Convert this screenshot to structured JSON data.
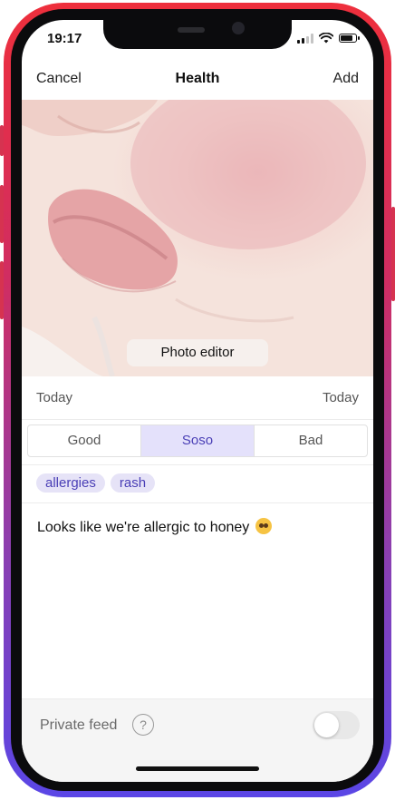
{
  "status": {
    "time": "19:17",
    "battery_level": 0.85
  },
  "navbar": {
    "cancel_label": "Cancel",
    "title": "Health",
    "add_label": "Add"
  },
  "photo": {
    "editor_label": "Photo editor"
  },
  "date_row": {
    "left": "Today",
    "right": "Today"
  },
  "mood": {
    "options": [
      "Good",
      "Soso",
      "Bad"
    ],
    "selected": "Soso"
  },
  "tags": [
    "allergies",
    "rash"
  ],
  "note": {
    "text": "Looks like we're allergic to honey",
    "emoji_icon": "pleading-face-emoji"
  },
  "footer": {
    "private_label": "Private feed",
    "help_symbol": "?",
    "private_enabled": false
  },
  "colors": {
    "accent": "#4a3fb6",
    "accent_light": "#e4e1fb",
    "frame_top": "#ee2f3c",
    "frame_bottom": "#5a46e6"
  }
}
